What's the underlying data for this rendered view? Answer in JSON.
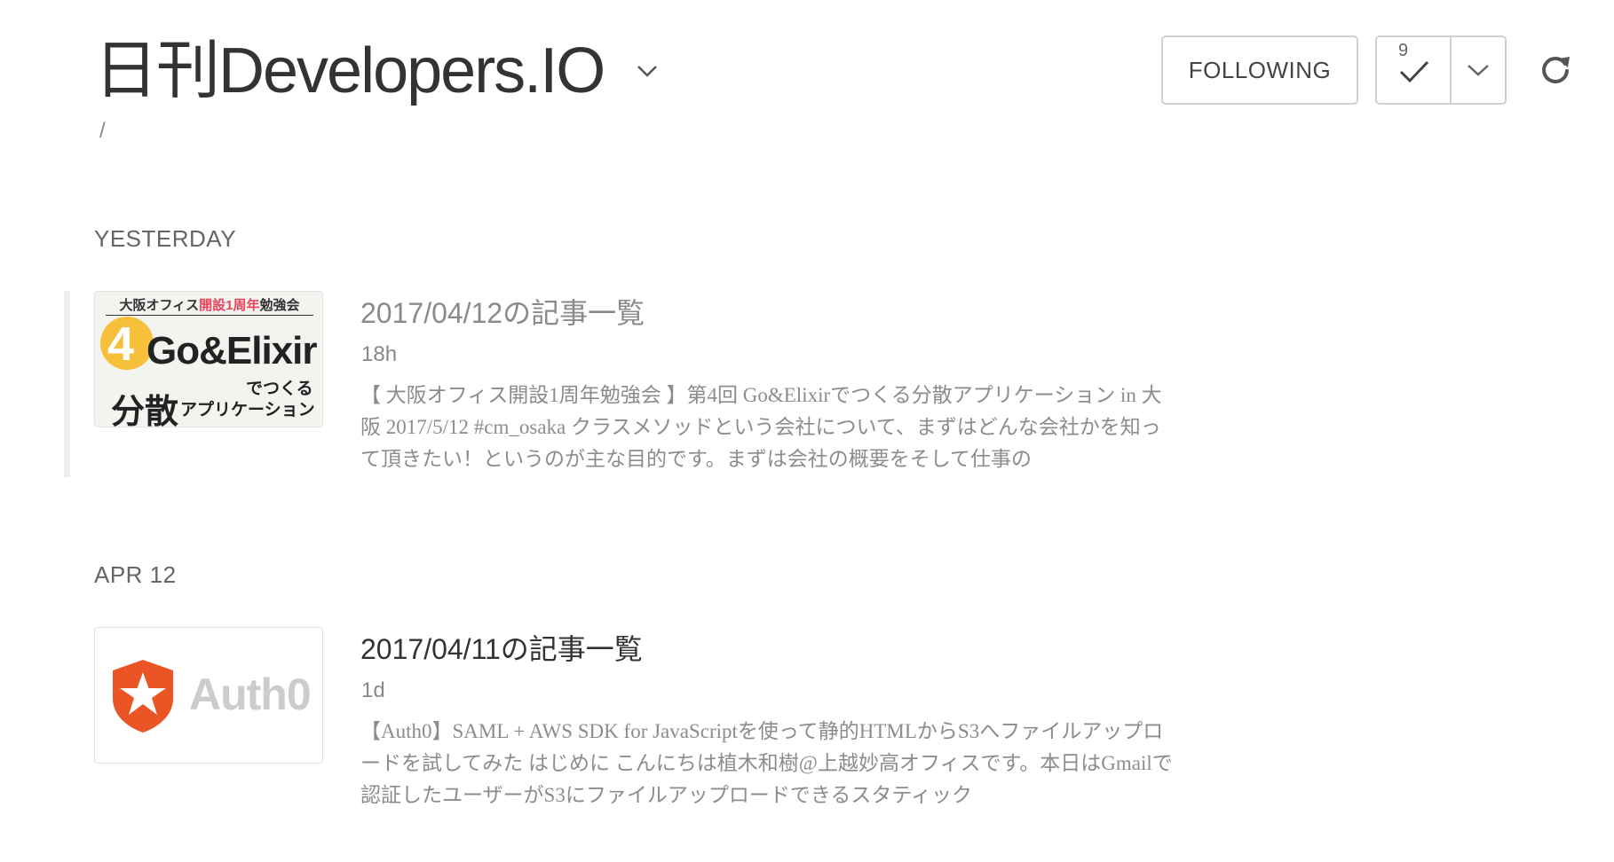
{
  "header": {
    "feed_title": "日刊Developers.IO",
    "breadcrumb": "/",
    "following_label": "FOLLOWING",
    "unread_count": "9"
  },
  "icons": {
    "title_dropdown": "chevron-down-icon",
    "mark_read": "check-icon",
    "mark_read_options": "chevron-down-icon",
    "refresh": "refresh-icon",
    "auth0_logo": "star-shield-icon"
  },
  "colors": {
    "auth0_brand": "#eb5424",
    "event_badge": "#f6c03a",
    "event_accent": "#e8455d"
  },
  "sections": [
    {
      "label": "YESTERDAY",
      "entries": [
        {
          "title": "2017/04/12の記事一覧",
          "age": "18h",
          "summary": "【 大阪オフィス開設1周年勉強会 】第4回 Go&Elixirでつくる分散アプリケーション in 大阪 2017/5/12 #cm_osaka クラスメソッドという会社について、まずはどんな会社かを知って頂きたい！というのが主な目的です。まずは会社の概要をそして仕事の",
          "read": true,
          "thumbnail": {
            "top_prefix": "大阪オフィス",
            "top_highlight": "開設1周年",
            "top_suffix": "勉強会",
            "number": "4",
            "main": "Go&Elixir",
            "sub": "でつくる",
            "big": "分散",
            "small": "アプリケーション"
          }
        }
      ]
    },
    {
      "label": "APR 12",
      "entries": [
        {
          "title": "2017/04/11の記事一覧",
          "age": "1d",
          "summary": "【Auth0】SAML + AWS SDK for JavaScriptを使って静的HTMLからS3へファイルアップロードを試してみた はじめに こんにちは植木和樹@上越妙高オフィスです。本日はGmailで認証したユーザーがS3にファイルアップロードできるスタティック",
          "read": false,
          "thumbnail": {
            "logo_text": "Auth0"
          }
        }
      ]
    }
  ]
}
